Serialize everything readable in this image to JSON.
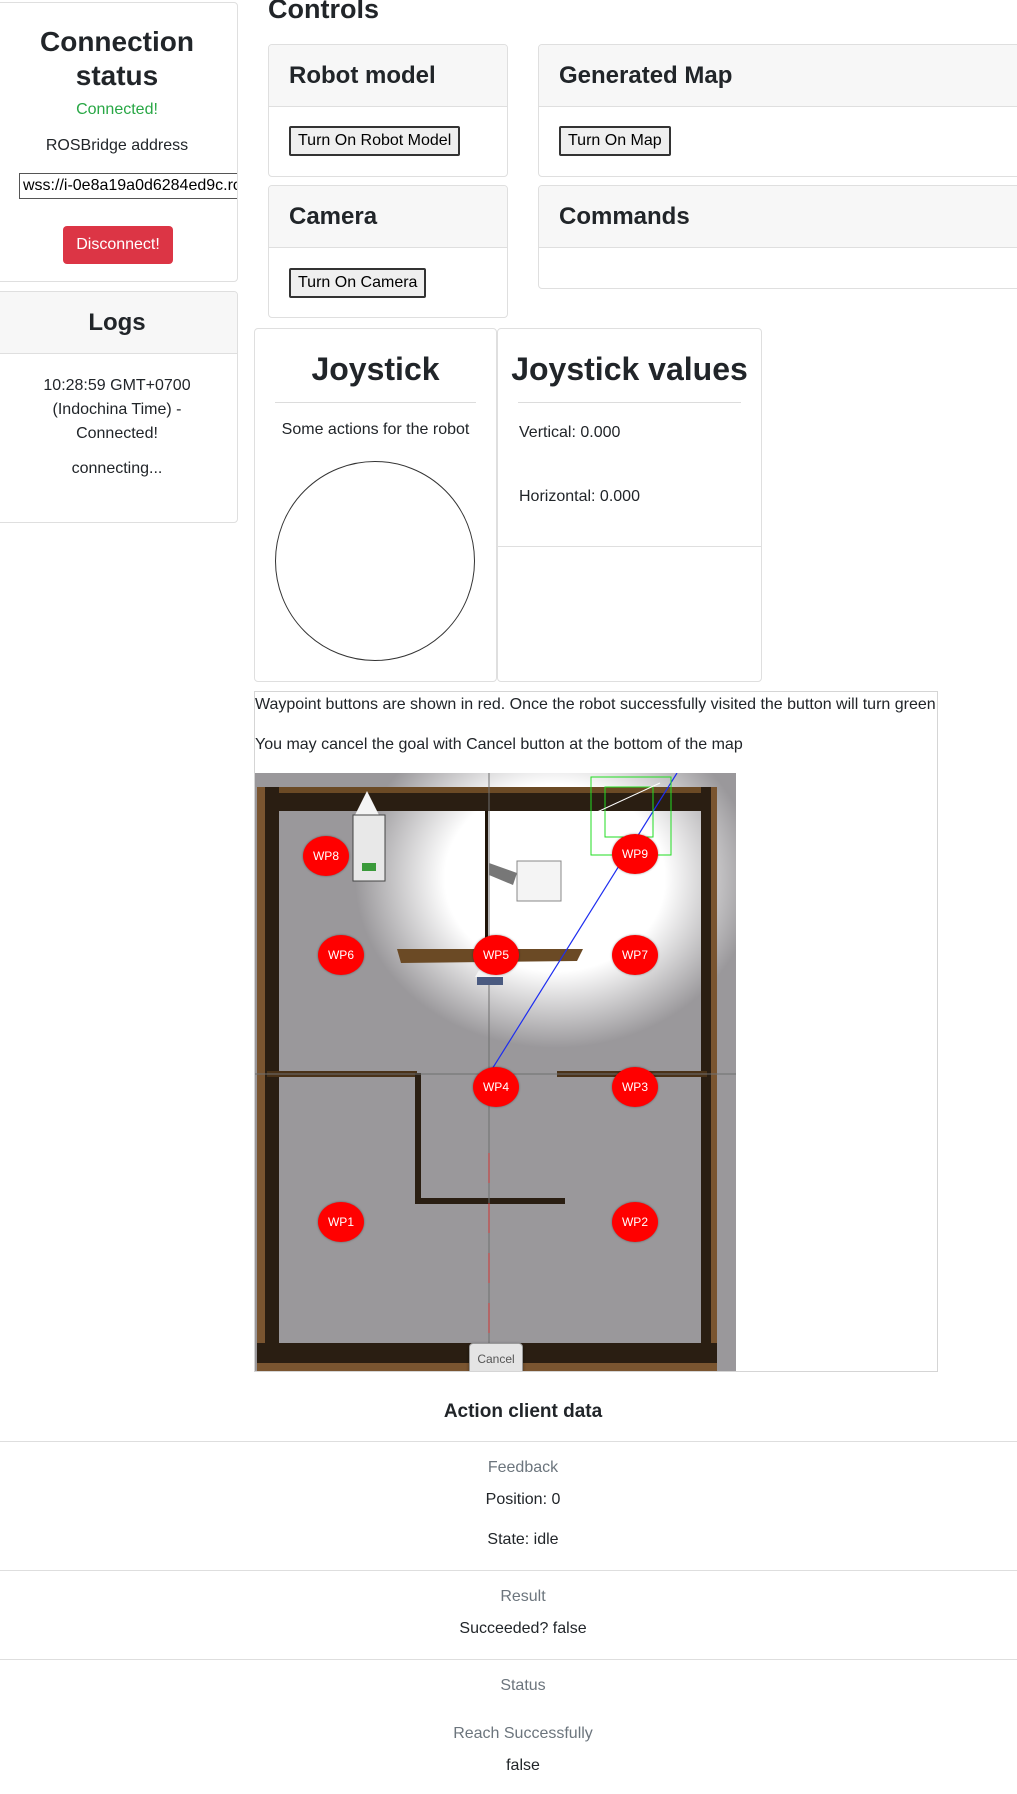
{
  "connection": {
    "title_line1": "Connection",
    "title_line2": "status",
    "status": "Connected!",
    "address_label": "ROSBridge address",
    "address_value": "wss://i-0e8a19a0d6284ed9c.ro",
    "disconnect_label": "Disconnect!"
  },
  "logs": {
    "title": "Logs",
    "entries": [
      "10:28:59 GMT+0700 (Indochina Time) - Connected!",
      "connecting..."
    ]
  },
  "controls": {
    "title": "Controls",
    "robot_model": {
      "title": "Robot model",
      "button": "Turn On Robot Model"
    },
    "generated_map": {
      "title": "Generated Map",
      "button": "Turn On Map"
    },
    "camera": {
      "title": "Camera",
      "button": "Turn On Camera"
    },
    "commands": {
      "title": "Commands"
    }
  },
  "joystick": {
    "title": "Joystick",
    "subtitle": "Some actions for the robot"
  },
  "joystick_values": {
    "title": "Joystick values",
    "vertical": "Vertical: 0.000",
    "horizontal": "Horizontal: 0.000"
  },
  "waypoints": {
    "info_line1": "Waypoint buttons are shown in red. Once the robot successfully visited the button will turn green",
    "info_line2": "You may cancel the goal with Cancel button at the bottom of the map",
    "cancel_label": "Cancel",
    "labels": [
      "WP1",
      "WP2",
      "WP3",
      "WP4",
      "WP5",
      "WP6",
      "WP7",
      "WP8",
      "WP9"
    ],
    "pending_color": "#ff0000"
  },
  "action_client": {
    "title": "Action client data",
    "feedback_label": "Feedback",
    "position": "Position: 0",
    "state": "State: idle",
    "result_label": "Result",
    "succeeded": "Succeeded? false",
    "status_label": "Status",
    "reach_label": "Reach Successfully",
    "reach_value": "false"
  },
  "colors": {
    "success": "#28a745",
    "danger": "#dc3545",
    "muted": "#6c757d"
  }
}
